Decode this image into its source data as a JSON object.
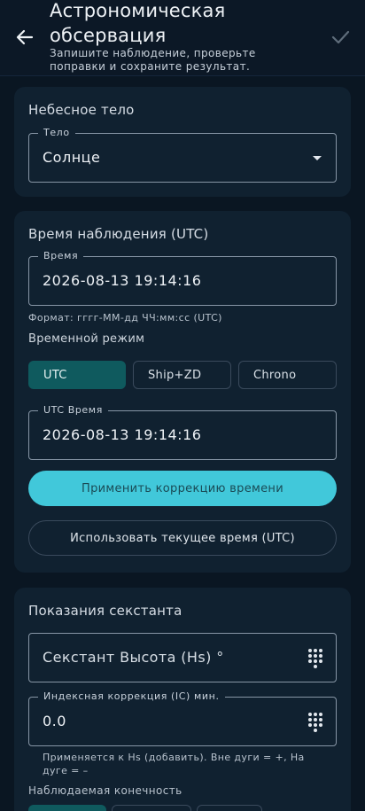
{
  "header": {
    "title": "Астрономическая обсервация",
    "subtitle": "Запишите наблюдение, проверьте поправки и сохраните результат.",
    "back_icon": "arrow-back-icon",
    "confirm_icon": "check-icon"
  },
  "celestial_body": {
    "section_title": "Небесное тело",
    "field_label": "Тело",
    "value": "Солнце"
  },
  "observation_time": {
    "section_title": "Время наблюдения (UTC)",
    "time_label": "Время",
    "time_value": "2026-08-13 19:14:16",
    "format_hint": "Формат: гггг-ММ-дд ЧЧ:мм:сс (UTC)",
    "mode_label": "Временной режим",
    "modes": [
      "UTC",
      "Ship+ZD",
      "Chrono"
    ],
    "selected_mode": "UTC",
    "utc_label": "UTC Время",
    "utc_value": "2026-08-13 19:14:16",
    "apply_button": "Применить коррекцию времени",
    "current_time_button": "Использовать текущее время (UTC)"
  },
  "sextant": {
    "section_title": "Показания секстанта",
    "hs_placeholder": "Секстант Высота (Hs) °",
    "ic_label": "Индексная коррекция (IC) мин.",
    "ic_value": "0.0",
    "ic_helper": "Применяется к Hs (добавить). Вне дуги = +, На дуге = –",
    "limb_label": "Наблюдаемая конечность"
  },
  "colors": {
    "background": "#0a1622",
    "card": "#102130",
    "accent": "#41c8da",
    "selected_segment": "#0f5a5e"
  }
}
